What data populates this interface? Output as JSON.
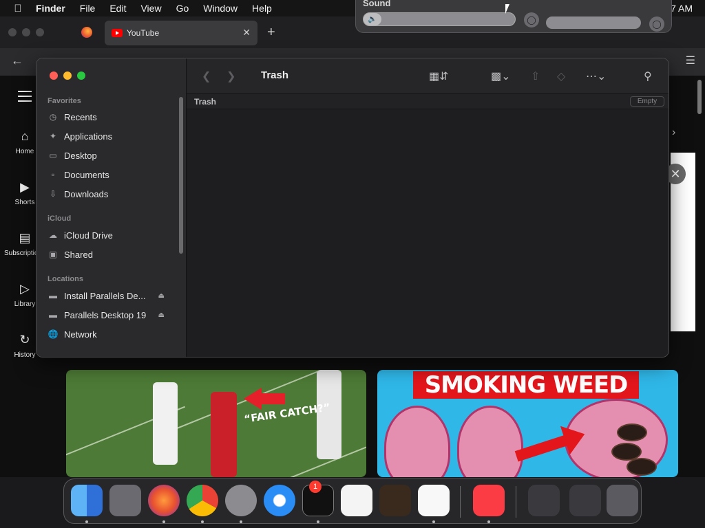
{
  "menubar": {
    "app_name": "Finder",
    "items": [
      "File",
      "Edit",
      "View",
      "Go",
      "Window",
      "Help"
    ],
    "clock": "7 AM"
  },
  "sound": {
    "title": "Sound",
    "volume_level": 0.12
  },
  "browser": {
    "tab_title": "YouTube",
    "tab_close": "✕",
    "new_tab": "+",
    "youtube_nav": [
      "Home",
      "Shorts",
      "Subscriptions",
      "Library",
      "History"
    ],
    "thumbnail_1_caption": "“FAIR CATCH?”",
    "thumbnail_2_banner": "SMOKING WEED"
  },
  "finder": {
    "title": "Trash",
    "path_label": "Trash",
    "empty_button": "Empty",
    "sidebar": {
      "favorites_header": "Favorites",
      "favorites": [
        {
          "label": "Recents",
          "icon": "clock-icon"
        },
        {
          "label": "Applications",
          "icon": "applications-icon"
        },
        {
          "label": "Desktop",
          "icon": "desktop-icon"
        },
        {
          "label": "Documents",
          "icon": "document-icon"
        },
        {
          "label": "Downloads",
          "icon": "download-icon"
        }
      ],
      "icloud_header": "iCloud",
      "icloud": [
        {
          "label": "iCloud Drive",
          "icon": "cloud-icon"
        },
        {
          "label": "Shared",
          "icon": "shared-folder-icon"
        }
      ],
      "locations_header": "Locations",
      "locations": [
        {
          "label": "Install Parallels De...",
          "icon": "drive-icon"
        },
        {
          "label": "Parallels Desktop 19",
          "icon": "drive-icon"
        },
        {
          "label": "Network",
          "icon": "network-icon"
        }
      ]
    }
  },
  "dock": {
    "apps": [
      "Finder",
      "Launchpad",
      "Firefox",
      "Chrome",
      "System Settings",
      "Safari",
      "Terminal",
      "TextEdit",
      "GarageBand",
      "Visual Studio Code",
      "Music"
    ],
    "settings_badge": "1"
  },
  "colors": {
    "traffic_red": "#ff5f57",
    "traffic_yellow": "#febc2e",
    "traffic_green": "#28c840",
    "youtube_red": "#ff0000"
  }
}
